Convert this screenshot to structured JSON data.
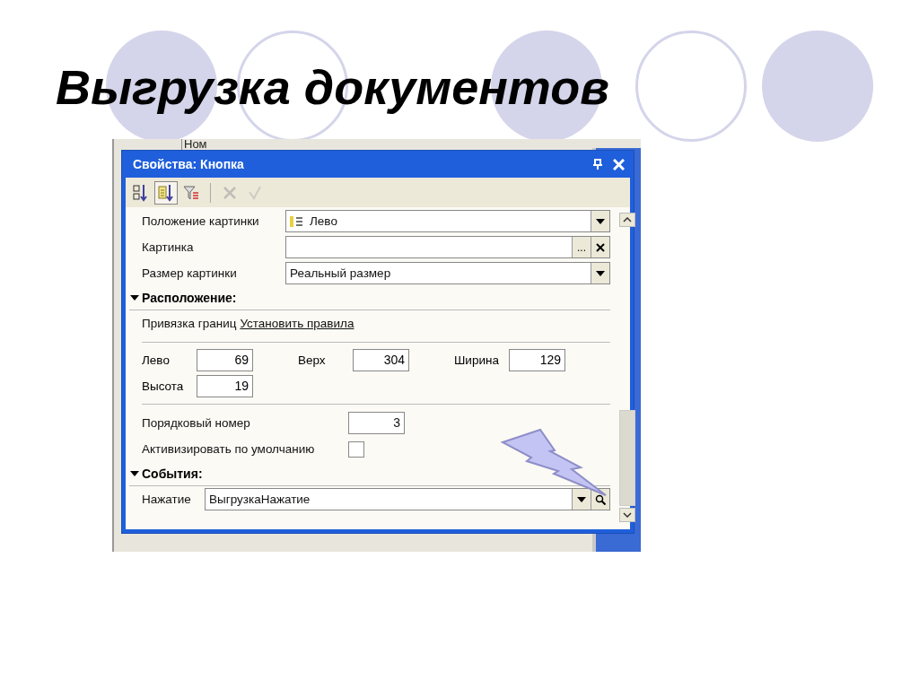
{
  "slide": {
    "title": "Выгрузка документов"
  },
  "background_window": {
    "column_header": "Ном"
  },
  "window": {
    "title": "Свойства: Кнопка"
  },
  "toolbar": [
    {
      "kind": "sort",
      "selected": false,
      "disabled": false
    },
    {
      "kind": "categories",
      "selected": true,
      "disabled": false
    },
    {
      "kind": "filter",
      "selected": false,
      "disabled": false
    },
    {
      "kind": "cancel",
      "selected": false,
      "disabled": true
    },
    {
      "kind": "apply",
      "selected": false,
      "disabled": true
    }
  ],
  "properties": [
    {
      "kind": "picture-dropdown",
      "label": "Положение картинки",
      "value": "Лево"
    },
    {
      "kind": "choice",
      "label": "Картинка",
      "choose_button": "..."
    },
    {
      "kind": "dropdown",
      "label": "Размер картинки",
      "value": "Реальный размер"
    },
    {
      "kind": "section",
      "label": "Расположение:",
      "expanded": true
    },
    {
      "kind": "link",
      "label": "Привязка границ",
      "link": "Установить правила"
    },
    {
      "kind": "divider"
    },
    {
      "kind": "coords",
      "items": [
        {
          "label": "Лево",
          "value": "69"
        },
        {
          "label": "Верх",
          "value": "304"
        },
        {
          "label": "Ширина",
          "value": "129"
        },
        {
          "label": "Высота",
          "value": "19"
        }
      ]
    },
    {
      "kind": "divider"
    },
    {
      "kind": "number",
      "label": "Порядковый номер",
      "value": "3"
    },
    {
      "kind": "checkbox",
      "label": "Активизировать по умолчанию",
      "checked": false
    },
    {
      "kind": "section",
      "label": "События:",
      "expanded": true
    },
    {
      "kind": "event",
      "label": "Нажатие",
      "value": "ВыгрузкаНажатие"
    }
  ]
}
